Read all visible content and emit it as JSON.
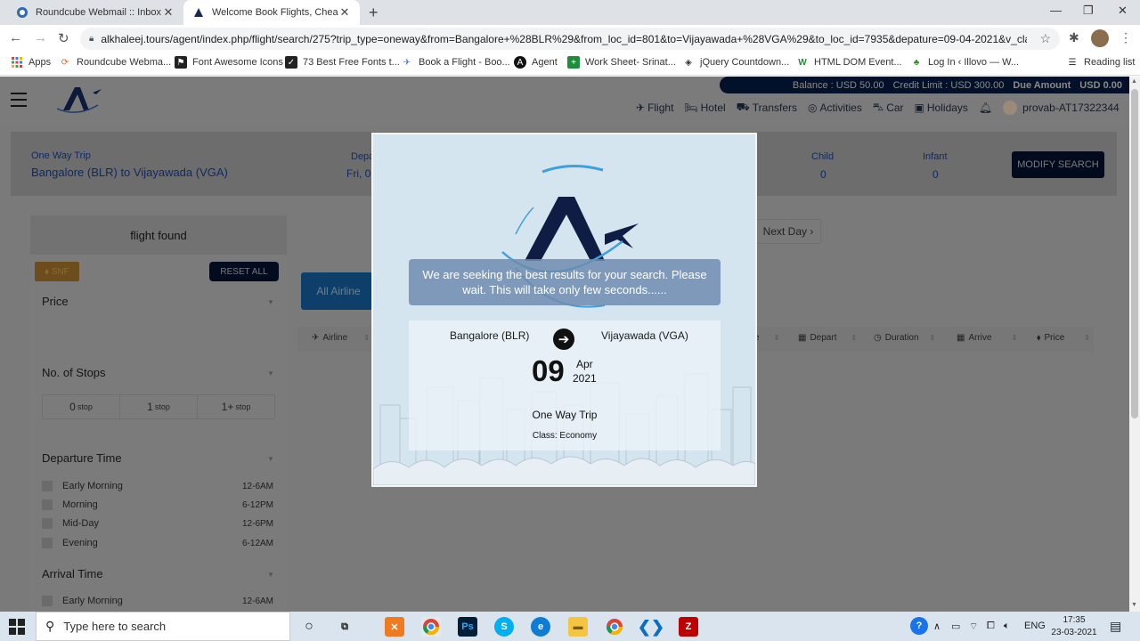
{
  "browser": {
    "tabs": [
      {
        "title": "Roundcube Webmail :: Inbox"
      },
      {
        "title": "Welcome Book Flights, Cheap Ai"
      }
    ],
    "url": "alkhaleej.tours/agent/index.php/flight/search/275?trip_type=oneway&from=Bangalore+%28BLR%29&from_loc_id=801&to=Vijayawada+%28VGA%29&to_loc_id=7935&depature=09-04-2021&v_class...",
    "bookmarks": [
      "Apps",
      "Roundcube Webma...",
      "Font Awesome Icons",
      "73 Best Free Fonts t...",
      "Book a Flight - Boo...",
      "Agent",
      "Work Sheet- Srinat...",
      "jQuery Countdown...",
      "HTML DOM Event...",
      "Log In ‹ Illovo — W...",
      "Reading list"
    ]
  },
  "header": {
    "balance": "Balance : USD 50.00",
    "credit_limit": "Credit Limit : USD 300.00",
    "due_amount_label": "Due Amount",
    "due_amount_value": "USD 0.00",
    "nav": [
      "Flight",
      "Hotel",
      "Transfers",
      "Activities",
      "Car",
      "Holidays"
    ],
    "user": "provab-AT17322344"
  },
  "summary": {
    "trip_type": "One Way Trip",
    "route": "Bangalore (BLR) to Vijayawada (VGA)",
    "depart_label": "Depa",
    "depart_value": "Fri, 0",
    "child_label": "Child",
    "child_value": "0",
    "infant_label": "Infant",
    "infant_value": "0",
    "modify_button": "MODIFY SEARCH"
  },
  "filters": {
    "found": "flight found",
    "snf": "SNF",
    "reset": "RESET ALL",
    "price_label": "Price",
    "stops_label": "No. of Stops",
    "stops": [
      {
        "num": "0",
        "unit": "stop"
      },
      {
        "num": "1",
        "unit": "stop"
      },
      {
        "num": "1+",
        "unit": "stop"
      }
    ],
    "departure_label": "Departure Time",
    "departure_times": [
      {
        "label": "Early Morning",
        "range": "12-6AM"
      },
      {
        "label": "Morning",
        "range": "6-12PM"
      },
      {
        "label": "Mid-Day",
        "range": "12-6PM"
      },
      {
        "label": "Evening",
        "range": "6-12AM"
      }
    ],
    "arrival_label": "Arrival Time",
    "arrival_times": [
      {
        "label": "Early Morning",
        "range": "12-6AM"
      }
    ]
  },
  "results": {
    "next_day": "Next Day ›",
    "all_airline": "All Airline",
    "sort": [
      "Airline",
      "Depart",
      "Duration",
      "Arrive",
      "Price"
    ]
  },
  "modal": {
    "message": "We are seeking the best results for your search. Please wait. This will take only few seconds......",
    "from": "Bangalore (BLR)",
    "to": "Vijayawada (VGA)",
    "day": "09",
    "month": "Apr",
    "year": "2021",
    "trip": "One Way Trip",
    "class": "Class: Economy"
  },
  "taskbar": {
    "search_placeholder": "Type here to search",
    "lang": "ENG",
    "time": "17:35",
    "date": "23-03-2021"
  },
  "colors": {
    "brand_navy": "#0e2a63",
    "dark_button": "#020a1e",
    "modal_bg": "#d4e5ef",
    "overlay_gray": "#7a7a7a"
  }
}
